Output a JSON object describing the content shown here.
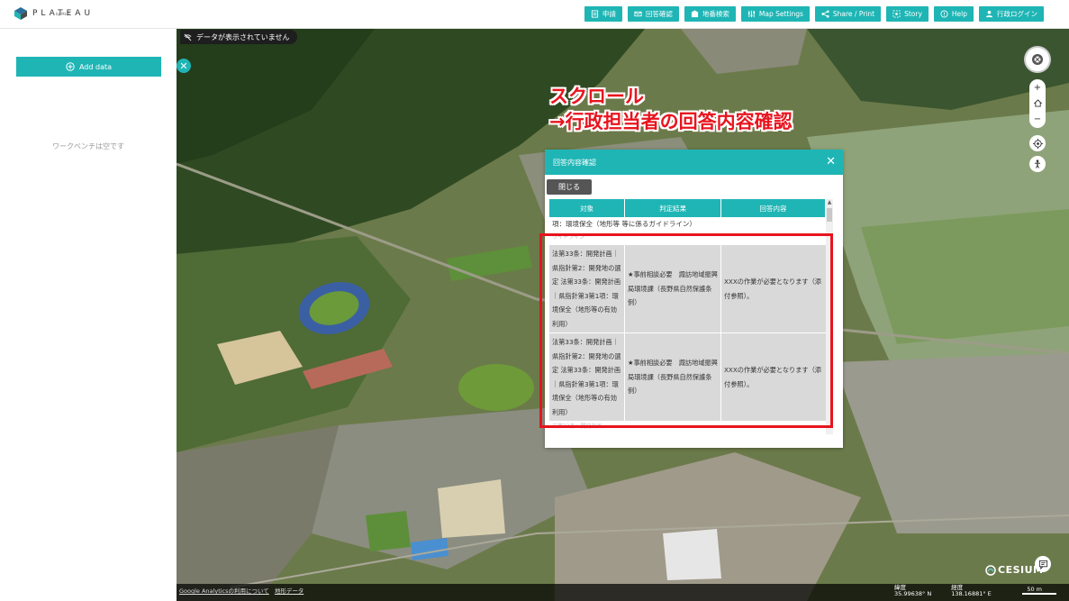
{
  "header": {
    "logo_text": "PLATEAU",
    "logo_sub": "by MLIT",
    "nav": [
      {
        "label": "申請",
        "icon": "document-icon"
      },
      {
        "label": "回答確認",
        "icon": "mail-icon"
      },
      {
        "label": "地番検索",
        "icon": "building-icon"
      },
      {
        "label": "Map Settings",
        "icon": "sliders-icon"
      },
      {
        "label": "Share / Print",
        "icon": "share-icon"
      },
      {
        "label": "Story",
        "icon": "story-icon"
      },
      {
        "label": "Help",
        "icon": "help-icon"
      },
      {
        "label": "行政ログイン",
        "icon": "user-icon"
      }
    ]
  },
  "sidebar": {
    "add_data": "Add data",
    "workbench_empty": "ワークベンチは空です"
  },
  "map": {
    "no_data_badge": "データが表示されていません",
    "annotation_line1": "スクロール",
    "annotation_line2": "→行政担当者の回答内容確認"
  },
  "dialog": {
    "title": "回答内容確認",
    "close_button": "閉じる",
    "columns": [
      "対象",
      "判定結果",
      "回答内容"
    ],
    "cut_row_text": "項：環境保全（地形等  等に係るガイドライン）",
    "faded_text_top": "ワイドライン",
    "faded_text_bottom": "法第33条：開発計画",
    "rows": [
      {
        "target": "法第33条：開発計画｜県指針第2：開発地の選定 法第33条：開発計画｜県指針第3第1項：環境保全（地形等の有効利用）",
        "result": "★事前相談必要　諏訪地域振興局環境課（長野県自然保護条例）",
        "answer": "XXXの作業が必要となります（添付参照）。"
      },
      {
        "target": "法第33条：開発計画｜県指針第2：開発地の選定 法第33条：開発計画｜県指針第3第1項：環境保全（地形等の有効利用）",
        "result": "★事前相談必要　諏訪地域振興局環境課（長野県自然保護条例）",
        "answer": "XXXの作業が必要となります（添付参照）。"
      }
    ]
  },
  "bottom": {
    "link1": "Google Analyticsの利用について",
    "link2": "地形データ",
    "lat_label": "緯度",
    "lat_value": "35.99638° N",
    "lon_label": "経度",
    "lon_value": "138.16881° E",
    "scale": "50 m",
    "cesium": "CESIUM"
  },
  "colors": {
    "accent": "#1fb5b5",
    "highlight": "#e8141e"
  }
}
